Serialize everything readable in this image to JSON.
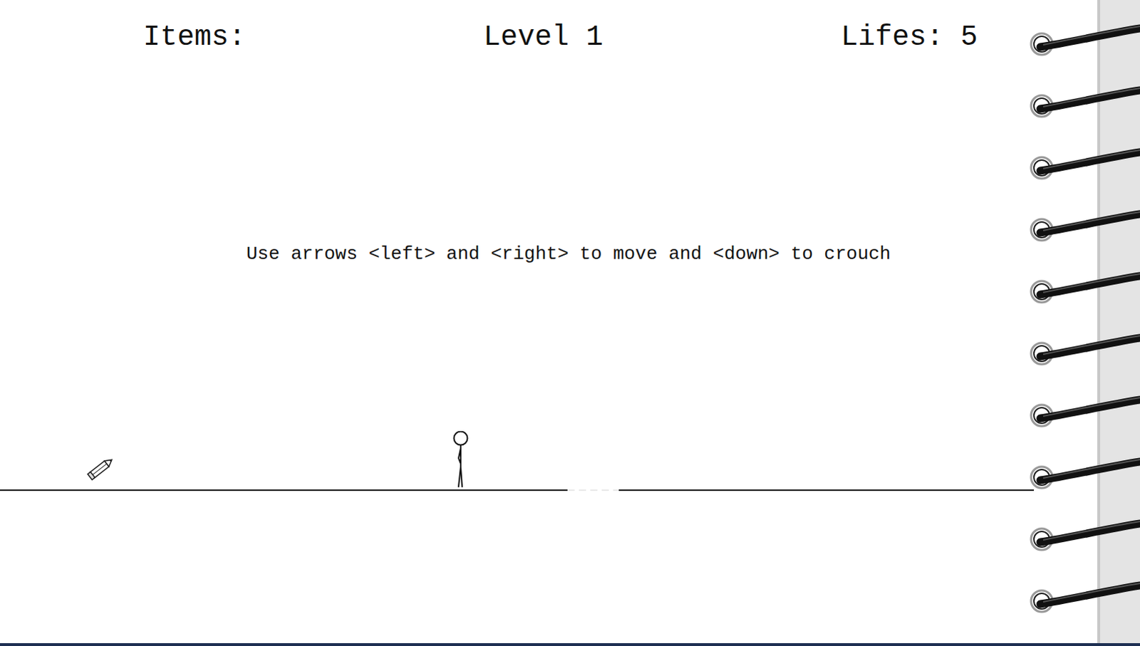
{
  "hud": {
    "items_label": "Items:",
    "items": [],
    "level": "Level 1",
    "lives": "Lifes: 5"
  },
  "hint": "Use arrows <left> and <right> to move and <down> to crouch",
  "player": {
    "crouching": false
  },
  "pickups": [
    {
      "kind": "pencil"
    }
  ],
  "ground": {
    "has_gap": true
  }
}
